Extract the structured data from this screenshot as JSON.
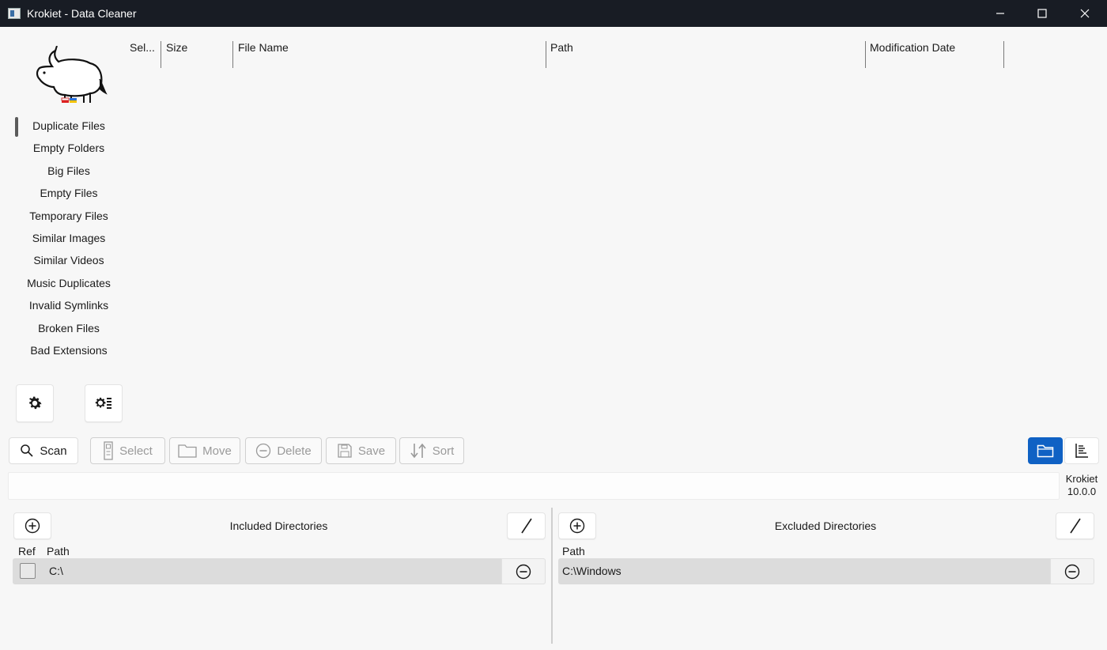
{
  "window": {
    "title": "Krokiet - Data Cleaner"
  },
  "logo": {
    "icon": "krokiet-logo-icon"
  },
  "sidebar": {
    "items": [
      {
        "label": "Duplicate Files",
        "active": true
      },
      {
        "label": "Empty Folders"
      },
      {
        "label": "Big Files"
      },
      {
        "label": "Empty Files"
      },
      {
        "label": "Temporary Files"
      },
      {
        "label": "Similar Images"
      },
      {
        "label": "Similar Videos"
      },
      {
        "label": "Music Duplicates"
      },
      {
        "label": "Invalid Symlinks"
      },
      {
        "label": "Broken Files"
      },
      {
        "label": "Bad Extensions"
      }
    ],
    "settings_icon": "gear-icon",
    "tool_settings_icon": "gear-list-icon"
  },
  "results_table": {
    "columns": [
      "Sel...",
      "Size",
      "File Name",
      "Path",
      "Modification Date"
    ]
  },
  "toolbar": {
    "scan": "Scan",
    "select": "Select",
    "move": "Move",
    "delete": "Delete",
    "save": "Save",
    "sort": "Sort"
  },
  "version": {
    "app": "Krokiet",
    "number": "10.0.0"
  },
  "included": {
    "title": "Included Directories",
    "col_ref": "Ref",
    "col_path": "Path",
    "rows": [
      {
        "path": "C:\\",
        "ref": false
      }
    ]
  },
  "excluded": {
    "title": "Excluded Directories",
    "col_path": "Path",
    "rows": [
      {
        "path": "C:\\Windows"
      }
    ]
  },
  "colors": {
    "accent": "#0f61c4",
    "titlebar": "#181c24",
    "row": "#dcdcdc"
  }
}
